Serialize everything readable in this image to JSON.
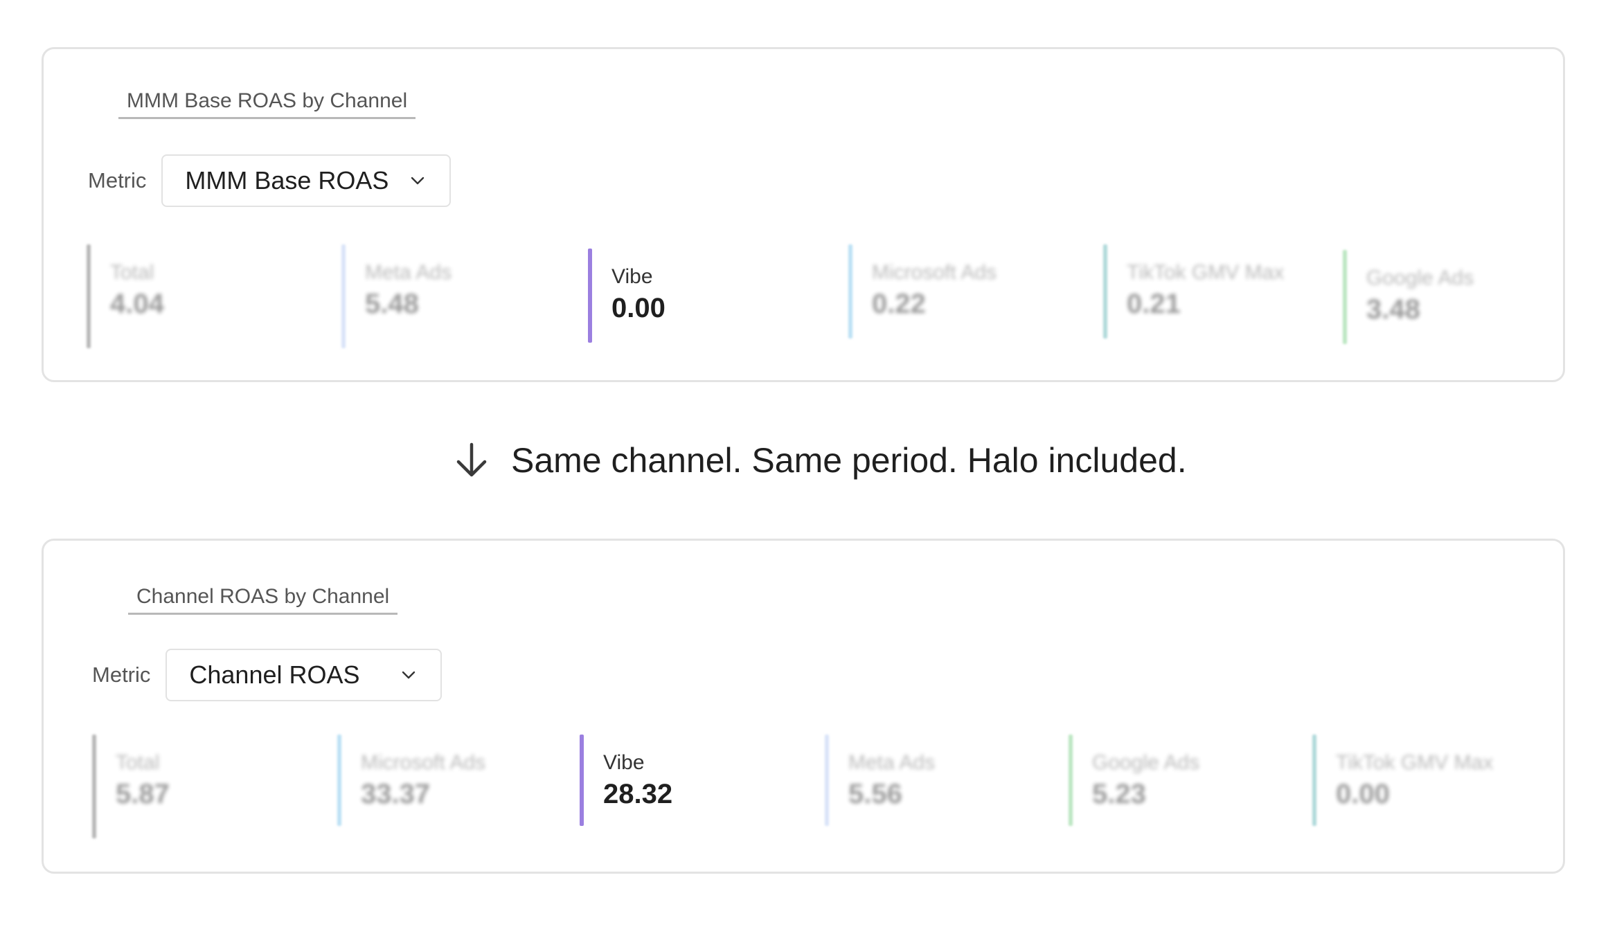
{
  "top_panel": {
    "title": "MMM Base ROAS by Channel",
    "metric_label": "Metric",
    "metric_value": "MMM Base ROAS",
    "channels": [
      {
        "name": "Total",
        "value": "4.04",
        "color": "#9a9a9a"
      },
      {
        "name": "Meta Ads",
        "value": "5.48",
        "color": "#c9d8f6"
      },
      {
        "name": "Vibe",
        "value": "0.00",
        "color": "#9b7fe0"
      },
      {
        "name": "Microsoft Ads",
        "value": "0.22",
        "color": "#9fd4f0"
      },
      {
        "name": "TikTok GMV Max",
        "value": "0.21",
        "color": "#8ec9cb"
      },
      {
        "name": "Google Ads",
        "value": "3.48",
        "color": "#9fdca8"
      }
    ]
  },
  "caption": {
    "icon": "arrow-down-icon",
    "text": "Same channel. Same period. Halo included."
  },
  "bottom_panel": {
    "title": "Channel ROAS by Channel",
    "metric_label": "Metric",
    "metric_value": "Channel ROAS",
    "channels": [
      {
        "name": "Total",
        "value": "5.87",
        "color": "#9a9a9a"
      },
      {
        "name": "Microsoft Ads",
        "value": "33.37",
        "color": "#9fd4f0"
      },
      {
        "name": "Vibe",
        "value": "28.32",
        "color": "#9b7fe0"
      },
      {
        "name": "Meta Ads",
        "value": "5.56",
        "color": "#c9d8f6"
      },
      {
        "name": "Google Ads",
        "value": "5.23",
        "color": "#9fdca8"
      },
      {
        "name": "TikTok GMV Max",
        "value": "0.00",
        "color": "#8ec9cb"
      }
    ]
  }
}
